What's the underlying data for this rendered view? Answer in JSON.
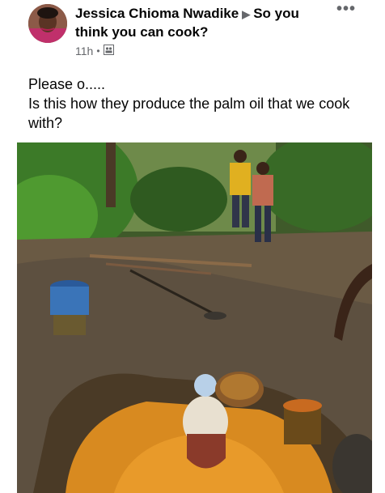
{
  "post": {
    "author": "Jessica Chioma Nwadike",
    "group": "So you think you can cook?",
    "time": "11h",
    "text_line1": "Please o.....",
    "text_line2": "Is this how they produce the palm oil that we cook with?"
  },
  "icons": {
    "separator": "play-arrow-icon",
    "audience": "group-icon",
    "menu": "more-options-icon"
  }
}
